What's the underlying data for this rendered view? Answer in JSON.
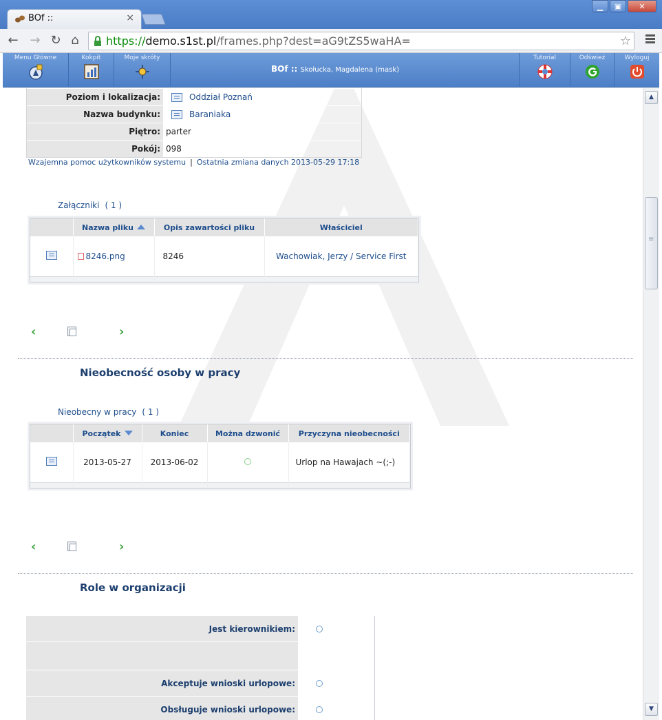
{
  "browser": {
    "tab_title": "BOf ::",
    "tab_close": "×",
    "url_scheme": "https://",
    "url_host": "demo.s1st.pl",
    "url_rest": "/frames.php?dest=aG9tZS5waHA=",
    "window_buttons": {
      "minimize": "▁",
      "maximize": "▣",
      "close": "✕"
    }
  },
  "appbar": {
    "left_buttons": [
      {
        "label": "Menu Główne",
        "icon": "compass-icon"
      },
      {
        "label": "Kokpit",
        "icon": "dashboard-chart-icon"
      },
      {
        "label": "Moje skróty",
        "icon": "shortcuts-icon"
      }
    ],
    "title": "BOf ::",
    "subtitle": "Skołucka, Magdalena (mask)",
    "right_buttons": [
      {
        "label": "Tutorial",
        "icon": "lifebuoy-icon"
      },
      {
        "label": "Odśwież",
        "icon": "refresh-icon"
      },
      {
        "label": "Wyloguj",
        "icon": "power-icon"
      }
    ]
  },
  "location": {
    "rows": [
      {
        "key": "Poziom i lokalizacja:",
        "value": "Oddział Poznań",
        "is_link": true
      },
      {
        "key": "Nazwa budynku:",
        "value": "Baraniaka",
        "is_link": true
      },
      {
        "key": "Piętro:",
        "value": "parter",
        "is_link": false
      },
      {
        "key": "Pokój:",
        "value": "098",
        "is_link": false
      }
    ],
    "footer_help": "Wzajemna pomoc użytkowników systemu",
    "footer_sep": "|",
    "footer_changed": "Ostatnia zmiana danych 2013-05-29 17:18"
  },
  "attachments": {
    "label": "Załączniki",
    "count": "( 1 )",
    "columns": [
      "Nazwa pliku",
      "Opis zawartości pliku",
      "Właściciel"
    ],
    "rows": [
      {
        "file": "8246.png",
        "description": "8246",
        "owner": "Wachowiak, Jerzy / Service First"
      }
    ]
  },
  "absence": {
    "title": "Nieobecność osoby w pracy",
    "label": "Nieobecny w pracy",
    "count": "( 1 )",
    "columns": [
      "Początek",
      "Koniec",
      "Można dzwonić",
      "Przyczyna nieobecności"
    ],
    "rows": [
      {
        "start": "2013-05-27",
        "end": "2013-06-02",
        "reason": "Urlop na Hawajach ~(;-)"
      }
    ]
  },
  "pager": {
    "prev": "‹",
    "next": "›"
  },
  "roles": {
    "title": "Role w organizacji",
    "rows": [
      {
        "key": "Jest kierownikiem:"
      },
      {
        "key": ""
      },
      {
        "key": "Akceptuje wnioski urlopowe:"
      },
      {
        "key": "Obsługuje wnioski urlopowe:"
      }
    ]
  },
  "colors": {
    "appbar": "#5a8bd0",
    "link": "#1d4d8c",
    "header_bg": "#e3e3e3",
    "pager_green": "#3ca23c"
  }
}
